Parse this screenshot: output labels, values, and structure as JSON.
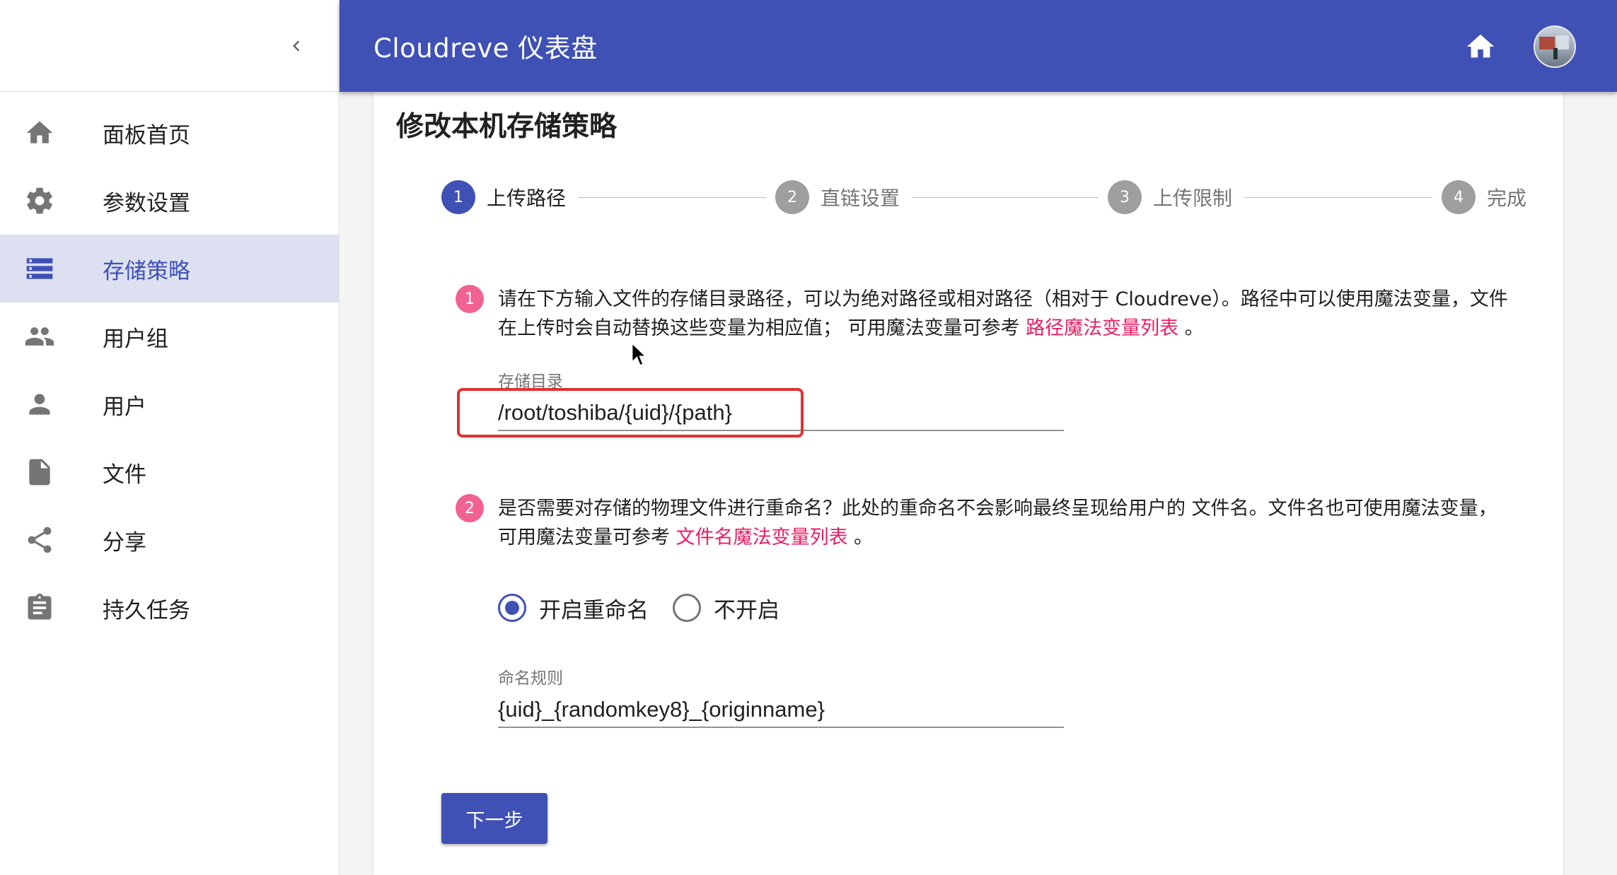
{
  "app": {
    "title": "Cloudreve 仪表盘"
  },
  "colors": {
    "primary": "#3f51b5",
    "accent": "#e91e63",
    "badge": "#f06292",
    "highlight": "#e03131"
  },
  "sidebar": {
    "collapse_icon": "chevron-left-icon",
    "items": [
      {
        "label": "面板首页",
        "icon": "home-icon",
        "active": false
      },
      {
        "label": "参数设置",
        "icon": "gear-icon",
        "active": false
      },
      {
        "label": "存储策略",
        "icon": "storage-icon",
        "active": true
      },
      {
        "label": "用户组",
        "icon": "group-icon",
        "active": false
      },
      {
        "label": "用户",
        "icon": "person-icon",
        "active": false
      },
      {
        "label": "文件",
        "icon": "file-icon",
        "active": false
      },
      {
        "label": "分享",
        "icon": "share-icon",
        "active": false
      },
      {
        "label": "持久任务",
        "icon": "assignment-icon",
        "active": false
      }
    ]
  },
  "page": {
    "title": "修改本机存储策略",
    "steps": [
      {
        "number": "1",
        "label": "上传路径",
        "active": true
      },
      {
        "number": "2",
        "label": "直链设置",
        "active": false
      },
      {
        "number": "3",
        "label": "上传限制",
        "active": false
      },
      {
        "number": "4",
        "label": "完成",
        "active": false
      }
    ],
    "section1": {
      "badge": "1",
      "text": "请在下方输入文件的存储目录路径，可以为绝对路径或相对路径（相对于 Cloudreve）。路径中可以使用魔法变量，文件在上传时会自动替换这些变量为相应值； 可用魔法变量可参考 ",
      "link": "路径魔法变量列表",
      "suffix": " 。",
      "field_label": "存储目录",
      "field_value": "/root/toshiba/{uid}/{path}"
    },
    "section2": {
      "badge": "2",
      "text": "是否需要对存储的物理文件进行重命名？此处的重命名不会影响最终呈现给用户的 文件名。文件名也可使用魔法变量， 可用魔法变量可参考 ",
      "link": "文件名魔法变量列表",
      "suffix": " 。",
      "radio_on": "开启重命名",
      "radio_off": "不开启",
      "selected": "开启重命名",
      "field_label": "命名规则",
      "field_value": "{uid}_{randomkey8}_{originname}"
    },
    "next_button": "下一步"
  }
}
